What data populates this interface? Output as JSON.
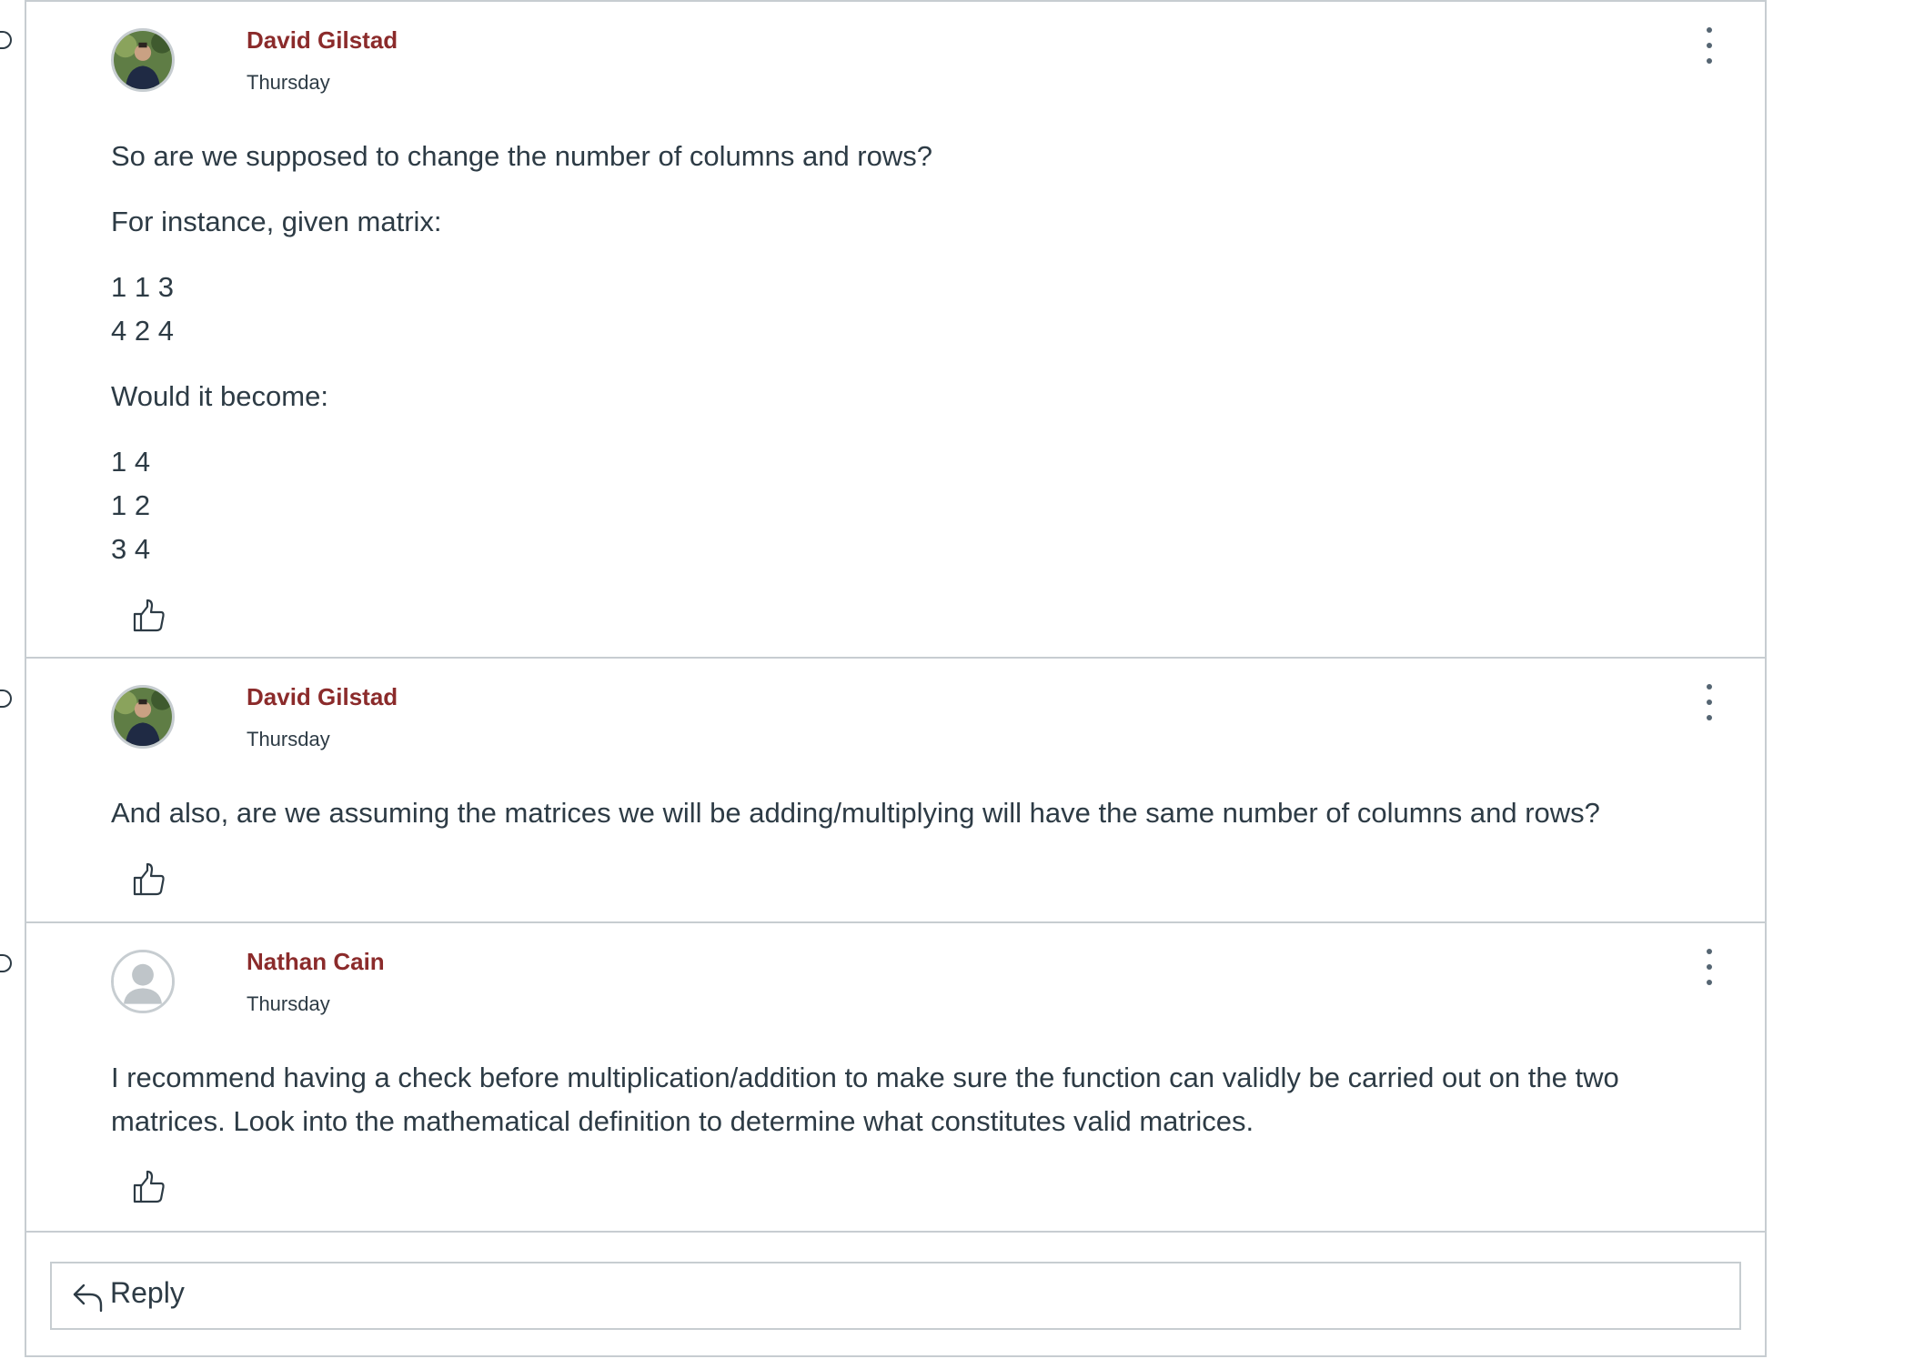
{
  "posts": [
    {
      "author": "David Gilstad",
      "timestamp": "Thursday",
      "paragraphs": [
        "So are we supposed to change the number of columns and rows?",
        "For instance, given matrix:"
      ],
      "matrix_a": [
        "1 1 3",
        "4 2 4"
      ],
      "middle": "Would it become:",
      "matrix_b": [
        "1 4",
        "1 2",
        "3 4"
      ]
    },
    {
      "author": "David Gilstad",
      "timestamp": "Thursday",
      "paragraphs": [
        "And also, are we assuming the matrices we will be adding/multiplying will have the same number of columns and rows?"
      ]
    },
    {
      "author": "Nathan Cain",
      "timestamp": "Thursday",
      "text": "I recommend having a check before multiplication/addition to make sure the function can validly be carried out on the two matrices. Look into the mathematical definition to determine what constitutes valid matrices."
    }
  ],
  "reply": {
    "label": "Reply"
  },
  "colors": {
    "author": "#8b2b2b",
    "text": "#2d3b45",
    "border": "#c7cdd1"
  },
  "icons": [
    "avatar-photo",
    "avatar-placeholder",
    "kebab-menu-icon",
    "thumbs-up-icon",
    "reply-arrow-icon"
  ]
}
